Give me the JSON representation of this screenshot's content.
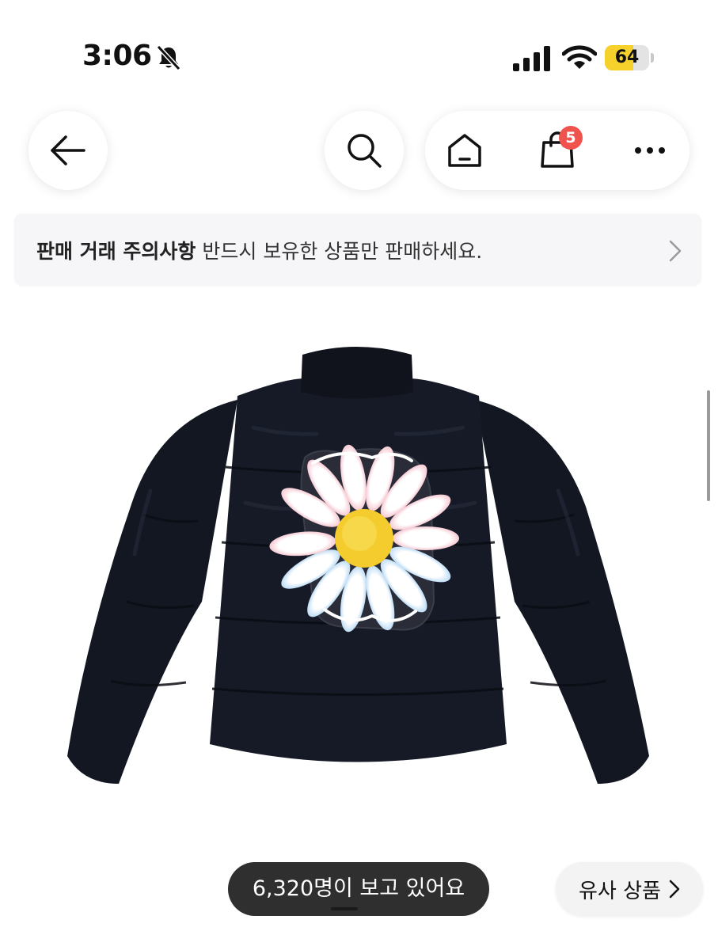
{
  "status_bar": {
    "time": "3:06",
    "battery_level": "64",
    "battery_fraction": 0.64,
    "battery_color": "#f6d12c",
    "icons": [
      "bell-off-icon",
      "cellular-signal-icon",
      "wifi-icon",
      "battery-icon"
    ]
  },
  "nav": {
    "icons": [
      "back-arrow-icon",
      "search-icon",
      "home-icon",
      "shopping-bag-icon",
      "more-icon"
    ],
    "cart_count": "5",
    "badge_color": "#f0534e"
  },
  "notice": {
    "title": "판매 거래 주의사항",
    "message": "반드시 보유한 상품만 판매하세요.",
    "icon": "chevron-right-icon"
  },
  "product": {
    "image_subject": "black puffer jacket with daisy patch",
    "jacket_color": "#151925"
  },
  "viewers": {
    "text": "6,320명이 보고 있어요"
  },
  "similar": {
    "label": "유사 상품",
    "icon": "chevron-right-icon"
  }
}
